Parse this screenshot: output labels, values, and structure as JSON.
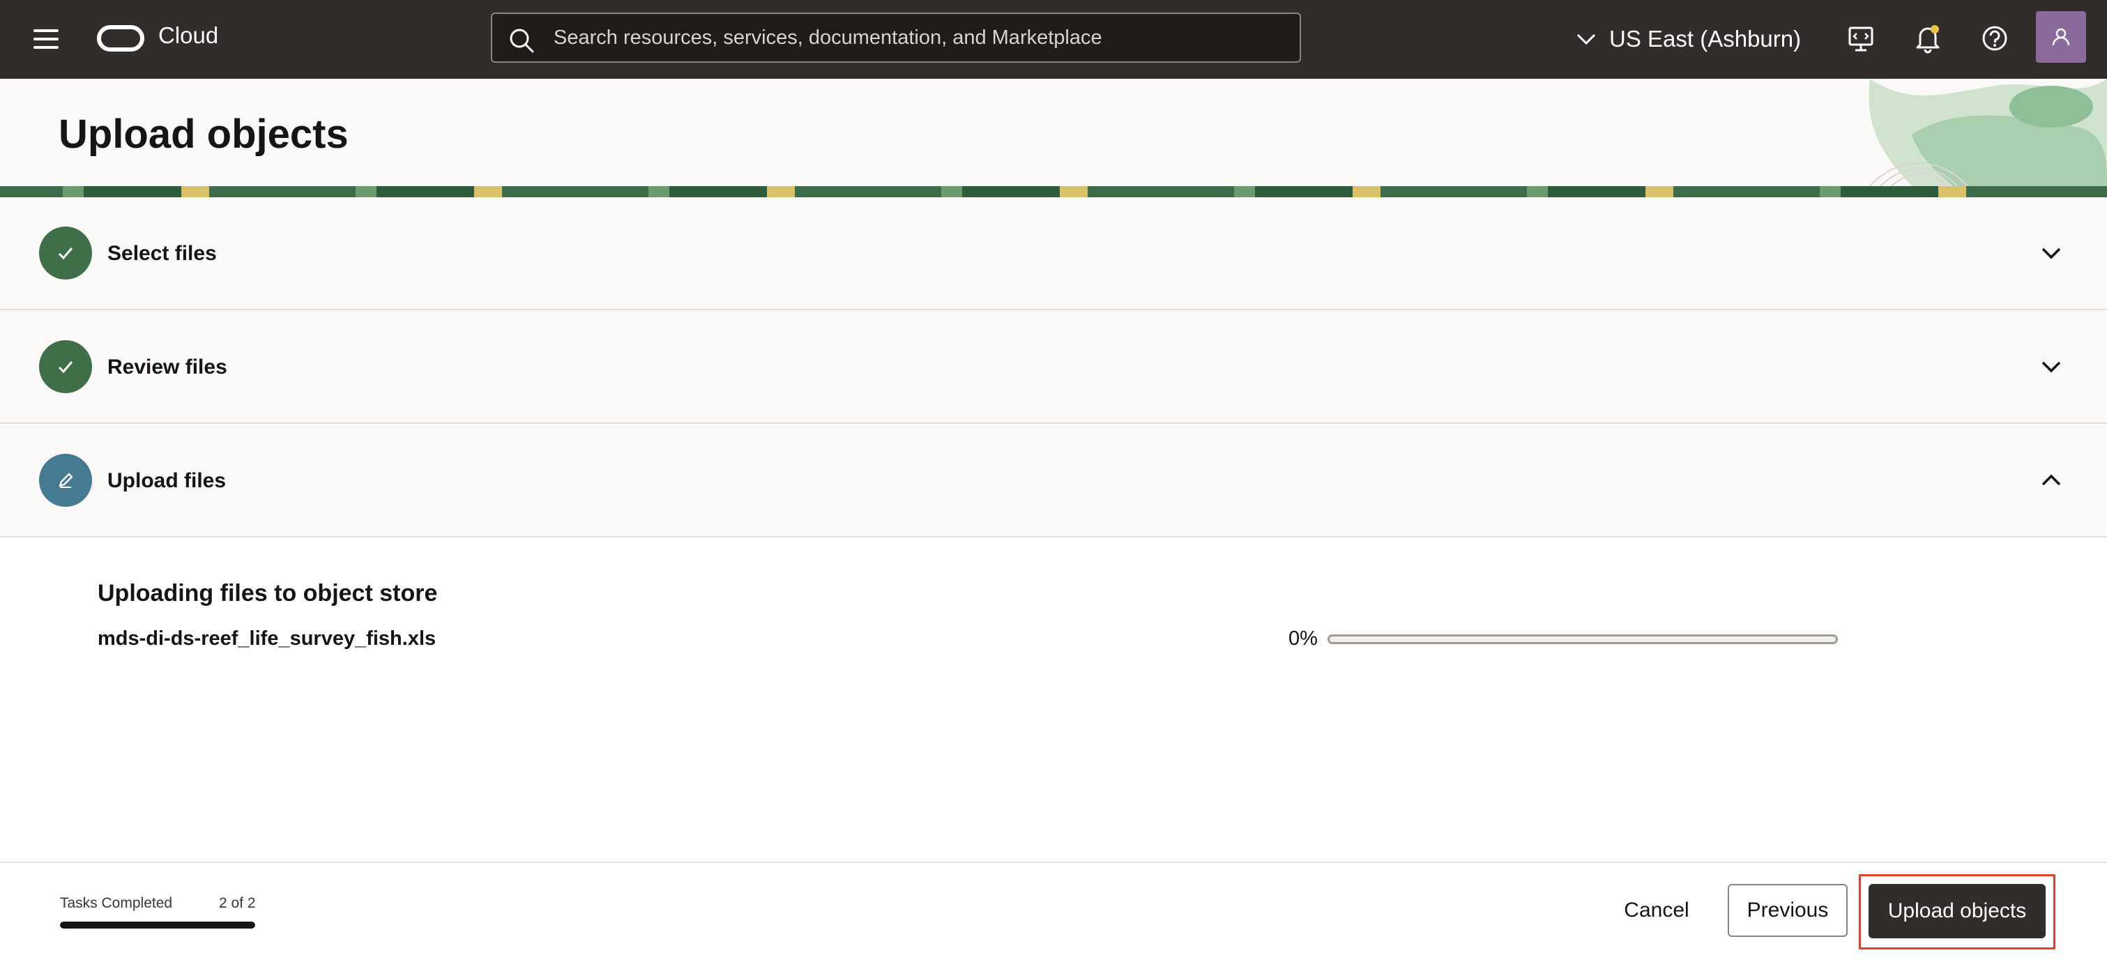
{
  "nav": {
    "app_name": "Cloud",
    "search_placeholder": "Search resources, services, documentation, and Marketplace",
    "region": "US East (Ashburn)"
  },
  "page": {
    "title": "Upload objects"
  },
  "steps": [
    {
      "label": "Select files",
      "status": "complete",
      "expanded": false
    },
    {
      "label": "Review files",
      "status": "complete",
      "expanded": false
    },
    {
      "label": "Upload files",
      "status": "in-progress",
      "expanded": true
    }
  ],
  "upload": {
    "heading": "Uploading files to object store",
    "files": [
      {
        "name": "mds-di-ds-reef_life_survey_fish.xls",
        "progress_label": "0%",
        "progress_fraction": 0
      }
    ]
  },
  "footer": {
    "tasks_label": "Tasks Completed",
    "tasks_count": "2 of 2",
    "tasks_fraction": 1,
    "cancel_label": "Cancel",
    "previous_label": "Previous",
    "upload_label": "Upload objects"
  },
  "colors": {
    "topbar": "#312d2a",
    "step_complete": "#3e6f48",
    "step_active": "#457a93",
    "highlight": "#e0402e"
  },
  "icons": {
    "menu": "hamburger-menu-icon",
    "logo": "oracle-logo-icon",
    "search": "search-icon",
    "region": "chevron-down-icon",
    "cloud_shell": "cloud-shell-icon",
    "notifications": "bell-icon",
    "help": "help-icon",
    "profile": "user-icon",
    "step_done": "checkmark-icon",
    "step_edit": "pencil-icon"
  }
}
